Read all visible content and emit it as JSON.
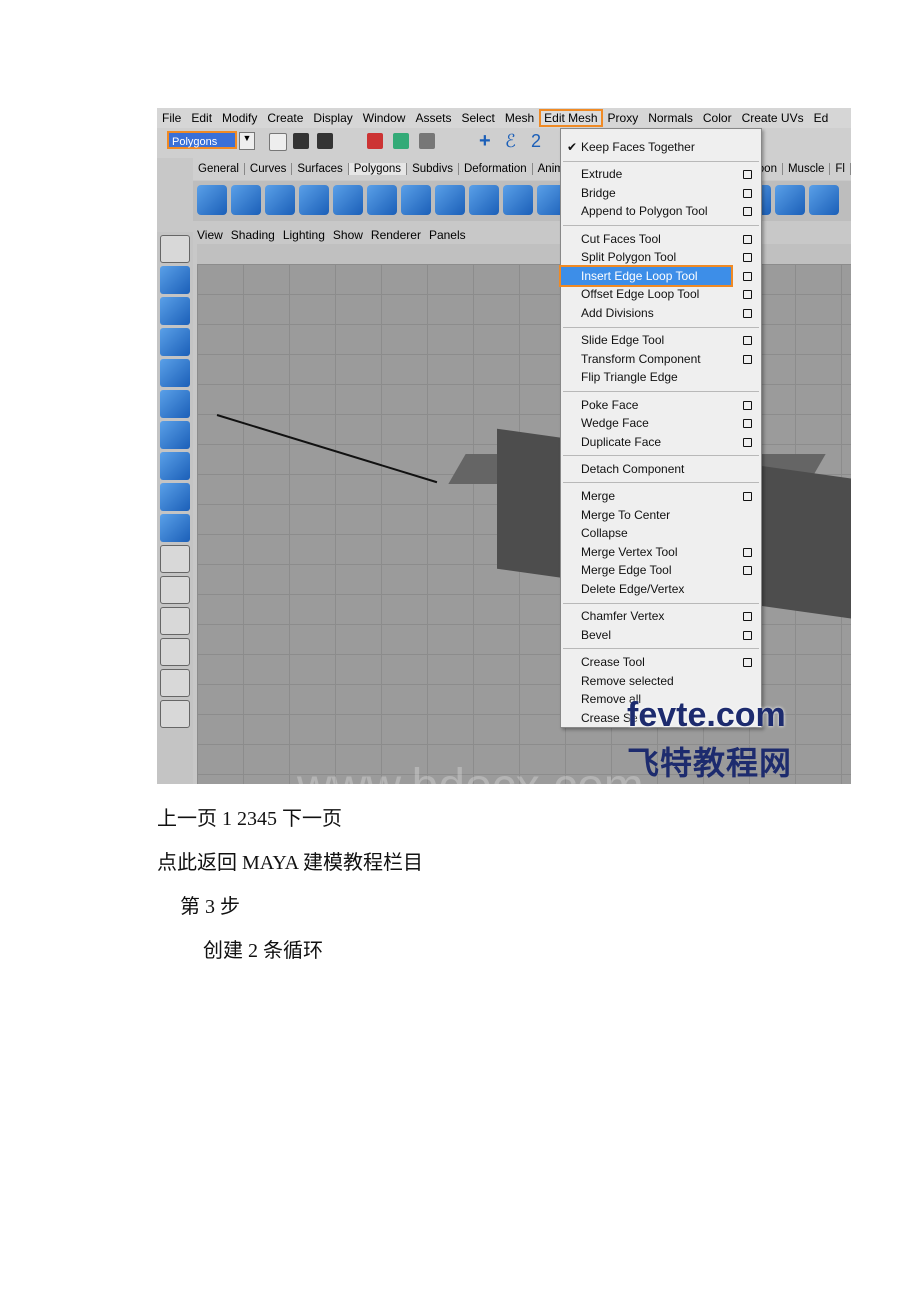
{
  "screenshot": {
    "menubar": [
      "File",
      "Edit",
      "Modify",
      "Create",
      "Display",
      "Window",
      "Assets",
      "Select",
      "Mesh",
      "Edit Mesh",
      "Proxy",
      "Normals",
      "Color",
      "Create UVs",
      "Ed"
    ],
    "mode_selector": "Polygons",
    "shelf_tabs": [
      "General",
      "Curves",
      "Surfaces",
      "Polygons",
      "Subdivs",
      "Deformation",
      "Animation"
    ],
    "shelf_tabs_right": [
      "oon",
      "Muscle",
      "Fl"
    ],
    "panel_menu": [
      "View",
      "Shading",
      "Lighting",
      "Show",
      "Renderer",
      "Panels"
    ],
    "edit_mesh_menu": {
      "groups": [
        [
          {
            "label": "Keep Faces Together",
            "checked": true
          }
        ],
        [
          {
            "label": "Extrude",
            "options": true
          },
          {
            "label": "Bridge",
            "options": true
          },
          {
            "label": "Append to Polygon Tool",
            "options": true
          }
        ],
        [
          {
            "label": "Cut Faces Tool",
            "options": true
          },
          {
            "label": "Split Polygon Tool",
            "options": true
          },
          {
            "label": "Insert Edge Loop Tool",
            "options": true,
            "highlighted": true
          },
          {
            "label": "Offset Edge Loop Tool",
            "options": true
          },
          {
            "label": "Add Divisions",
            "options": true
          }
        ],
        [
          {
            "label": "Slide Edge Tool",
            "options": true
          },
          {
            "label": "Transform Component",
            "options": true
          },
          {
            "label": "Flip Triangle Edge"
          }
        ],
        [
          {
            "label": "Poke Face",
            "options": true
          },
          {
            "label": "Wedge Face",
            "options": true
          },
          {
            "label": "Duplicate Face",
            "options": true
          }
        ],
        [
          {
            "label": "Detach Component"
          }
        ],
        [
          {
            "label": "Merge",
            "options": true
          },
          {
            "label": "Merge To Center"
          },
          {
            "label": "Collapse"
          },
          {
            "label": "Merge Vertex Tool",
            "options": true
          },
          {
            "label": "Merge Edge Tool",
            "options": true
          },
          {
            "label": "Delete Edge/Vertex"
          }
        ],
        [
          {
            "label": "Chamfer Vertex",
            "options": true
          },
          {
            "label": "Bevel",
            "options": true
          }
        ],
        [
          {
            "label": "Crease Tool",
            "options": true
          },
          {
            "label": "Remove selected"
          },
          {
            "label": "Remove all"
          },
          {
            "label": "Crease Se"
          }
        ]
      ]
    },
    "watermark": "www.bdocx.com",
    "logo_text": "fevte.com",
    "logo_subtitle": "飞特教程网",
    "highlight_color": "#f08a24"
  },
  "doc": {
    "pagination": "上一页 1 2345 下一页",
    "back_link": "点此返回 MAYA 建模教程栏目",
    "step": "第 3 步",
    "instruction": "创建 2 条循环"
  }
}
